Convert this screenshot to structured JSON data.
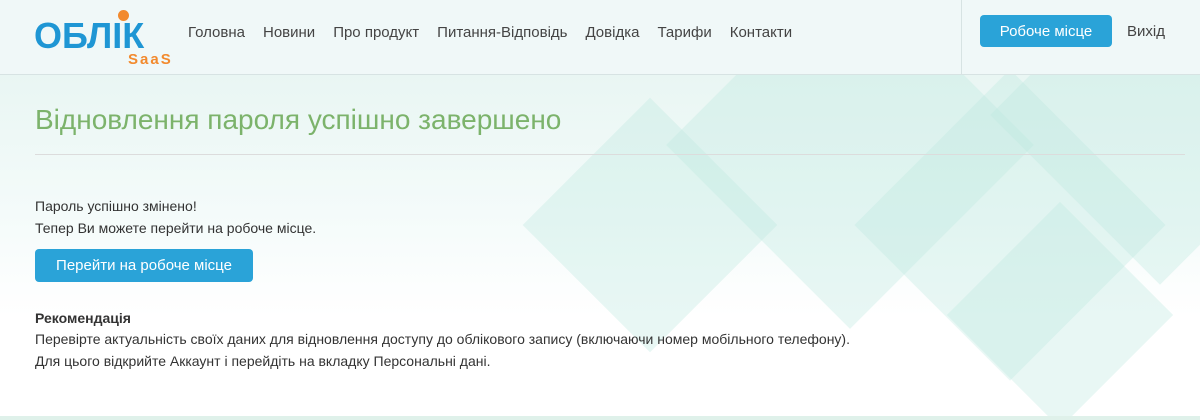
{
  "logo": {
    "word": "ОБЛІК",
    "sub": "SaaS"
  },
  "nav": {
    "items": [
      {
        "label": "Головна"
      },
      {
        "label": "Новини"
      },
      {
        "label": "Про продукт"
      },
      {
        "label": "Питання-Відповідь"
      },
      {
        "label": "Довідка"
      },
      {
        "label": "Тарифи"
      },
      {
        "label": "Контакти"
      }
    ]
  },
  "header": {
    "workspace_button": "Робоче місце",
    "logout": "Вихід"
  },
  "main": {
    "title": "Відновлення пароля успішно завершено",
    "line1": "Пароль успішно змінено!",
    "line2": "Тепер Ви можете перейти на робоче місце.",
    "go_button": "Перейти на робоче місце",
    "recommendation_title": "Рекомендація",
    "recommendation_line1": "Перевірте актуальність своїх даних для відновлення доступу до облікового запису (включаючи номер мобільного телефону).",
    "recommendation_line2": "Для цього відкрийте Аккаунт і перейдіть на вкладку Персональні дані."
  },
  "colors": {
    "brand_blue": "#1f96d4",
    "brand_orange": "#f28a2e",
    "title_green": "#7cb36b",
    "button_blue": "#2aa3d8"
  }
}
